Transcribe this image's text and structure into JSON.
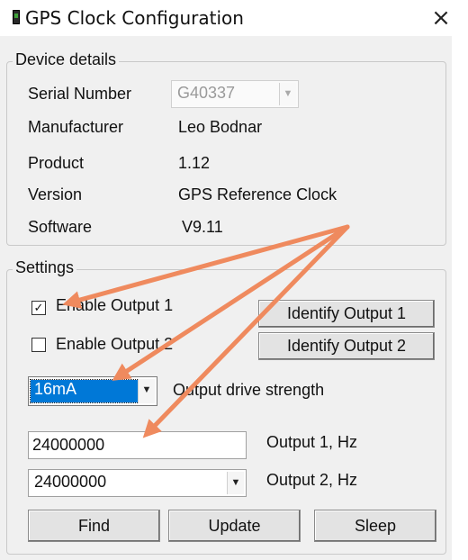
{
  "window": {
    "title": "GPS Clock Configuration",
    "close_glyph": "×"
  },
  "device_details": {
    "legend": "Device details",
    "serial_label": "Serial Number",
    "serial_value": "G40337",
    "manufacturer_label": "Manufacturer",
    "manufacturer_value": "Leo Bodnar",
    "product_label": "Product",
    "product_value": "1.12",
    "version_label": "Version",
    "version_value": "GPS Reference Clock",
    "software_label": "Software",
    "software_value": "V9.11"
  },
  "settings": {
    "legend": "Settings",
    "enable_output1_label": "Enable Output 1",
    "enable_output1_checked": true,
    "enable_output2_label": "Enable Output 2",
    "enable_output2_checked": false,
    "identify_output1_label": "Identify Output 1",
    "identify_output2_label": "Identify Output 2",
    "drive_strength_value": "16mA",
    "drive_strength_label": "Output drive strength",
    "output1_hz_value": "24000000",
    "output1_hz_label": "Output 1, Hz",
    "output2_hz_value": "24000000",
    "output2_hz_label": "Output 2, Hz",
    "find_label": "Find",
    "update_label": "Update",
    "sleep_label": "Sleep"
  },
  "icons": {
    "app_icon": "gps-clock-app-icon",
    "close_icon": "close-icon",
    "checkmark_icon": "checkmark-icon",
    "dropdown_icon": "chevron-down-icon"
  },
  "colors": {
    "annotation_arrow": "#ef8a5e",
    "selection_highlight": "#0078d7"
  }
}
